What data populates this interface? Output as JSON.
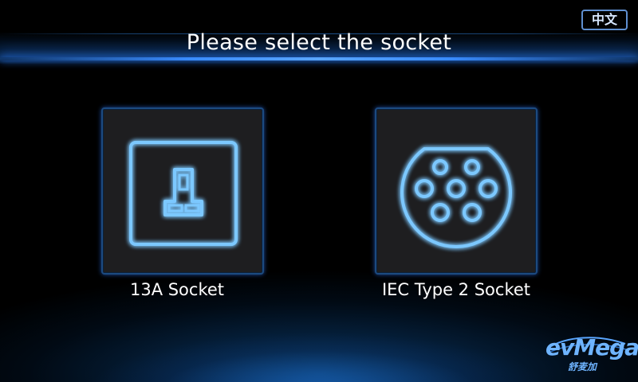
{
  "header": {
    "title": "Please select the socket",
    "language_button": "中文"
  },
  "sockets": [
    {
      "label": "13A Socket",
      "icon": "uk-13a-socket-icon"
    },
    {
      "label": "IEC Type 2 Socket",
      "icon": "iec-type2-socket-icon"
    }
  ],
  "brand": {
    "logo_text": "evMega",
    "logo_subtext": "舒麦加"
  },
  "colors": {
    "accent": "#3a8cff",
    "icon_glow": "#6fc0ff",
    "card_background": "#1e1e20"
  }
}
